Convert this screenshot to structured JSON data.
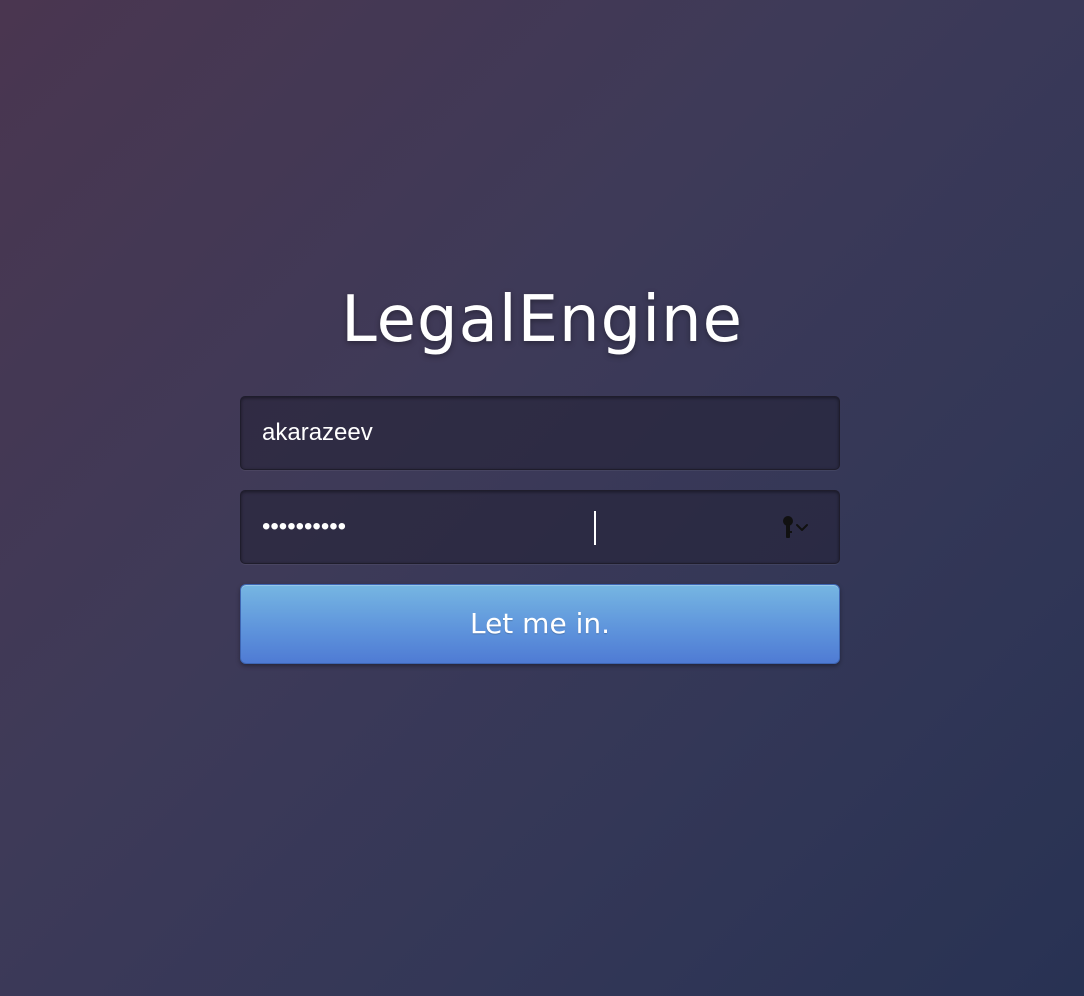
{
  "app": {
    "title": "LegalEngine"
  },
  "login": {
    "username": {
      "value": "akarazeev"
    },
    "password": {
      "value": "••••••••••",
      "keychain_icon": "key-icon"
    },
    "submit_label": "Let me in.",
    "colors": {
      "button_top": "#76b6e2",
      "button_bottom": "#4f7bd4",
      "background_start": "#4a3650",
      "background_end": "#283253"
    }
  }
}
